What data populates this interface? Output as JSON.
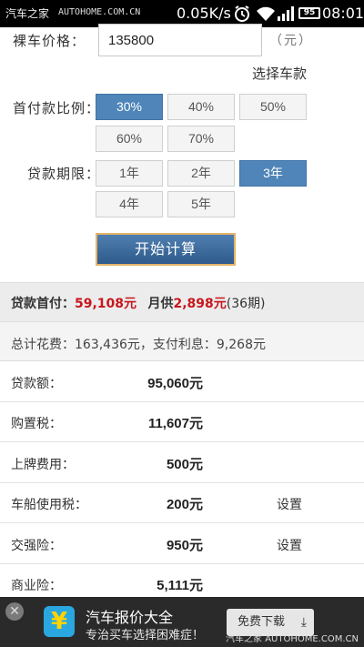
{
  "statusbar": {
    "watermark": "汽车之家",
    "url": "AUTOHOME.COM.CN",
    "speed": "0.05K/s",
    "battery": "95",
    "time": "08:01"
  },
  "form": {
    "price_label": "裸车价格：",
    "price_value": "135800",
    "unit": "（元）",
    "choose_model": "选择车款",
    "down_label": "首付款比例：",
    "down_options": [
      "30%",
      "40%",
      "50%",
      "60%",
      "70%"
    ],
    "down_selected": "30%",
    "term_label": "贷款期限：",
    "term_options": [
      "1年",
      "2年",
      "3年",
      "4年",
      "5年"
    ],
    "term_selected": "3年",
    "calc_button": "开始计算"
  },
  "summary": {
    "down_label": "贷款首付：",
    "down_value": "59,108元",
    "monthly_label": "月供",
    "monthly_value": "2,898元",
    "periods": "(36期)",
    "total_text": "总计花费：163,436元，支付利息：9,268元"
  },
  "rows": [
    {
      "label": "贷款额：",
      "value": "95,060元",
      "setting": ""
    },
    {
      "label": "购置税：",
      "value": "11,607元",
      "setting": ""
    },
    {
      "label": "上牌费用：",
      "value": "500元",
      "setting": ""
    },
    {
      "label": "车船使用税：",
      "value": "200元",
      "setting": "设置"
    },
    {
      "label": "交强险：",
      "value": "950元",
      "setting": "设置"
    },
    {
      "label": "商业险：",
      "value": "5,111元",
      "setting": ""
    }
  ],
  "ad": {
    "title": "汽车报价大全",
    "subtitle": "专治买车选择困难症！",
    "download": "免费下载",
    "watermark": "汽车之家 AUTOHOME.COM.CN"
  },
  "icons": {
    "alarm": "alarm-icon",
    "wifi": "wifi-icon",
    "signal": "signal-icon",
    "download": "download-icon",
    "close": "close-icon",
    "app_logo": "app-logo-icon"
  },
  "colors": {
    "selected_option": "#4f85b8",
    "price_red": "#c8161d",
    "button_border": "#e4b36a"
  }
}
